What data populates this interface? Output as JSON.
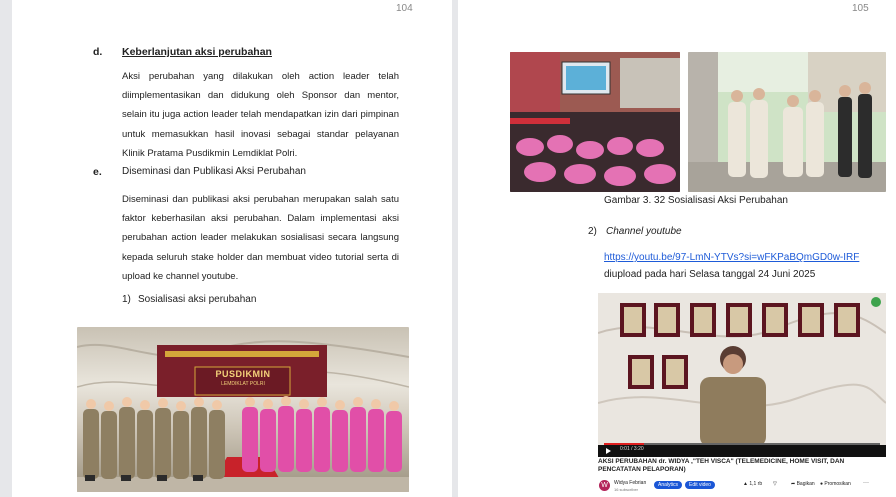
{
  "left_page": {
    "page_number": "104",
    "section_d": {
      "marker": "d.",
      "heading": "Keberlanjutan aksi perubahan",
      "body": "Aksi perubahan yang dilakukan oleh action leader telah diimplementasikan dan didukung oleh Sponsor dan mentor, selain itu juga action leader telah mendapatkan izin dari pimpinan untuk memasukkan hasil inovasi sebagai standar pelayanan Klinik Pratama Pusdikmin Lemdiklat Polri."
    },
    "section_e": {
      "marker": "e.",
      "heading": "Diseminasi dan Publikasi Aksi Perubahan",
      "body": "Diseminasi dan publikasi aksi perubahan merupakan salah satu faktor keberhasilan aksi perubahan. Dalam implementasi aksi perubahan action leader melakukan sosialisasi secara langsung kepada seluruh stake holder dan membuat video tutorial serta di upload ke channel youtube."
    },
    "subitem_1": {
      "marker": "1)",
      "label": "Sosialisasi aksi perubahan"
    },
    "photo_banner_line1": "PUSDIKMIN",
    "photo_banner_line2": "LEMDIKLAT POLRI"
  },
  "right_page": {
    "page_number": "105",
    "figure_caption": "Gambar 3. 32 Sosialisasi Aksi Perubahan",
    "subitem_2": {
      "marker": "2)",
      "label": "Channel youtube"
    },
    "link": "https://youtu.be/97-LmN-YTVs?si=wFKPaBQmGD0w-IRF",
    "upload_note": "diupload pada hari Selasa tanggal 24 Juni 2025",
    "video": {
      "title": "AKSI PERUBAHAN dr. WIDYA ,\"TEH VISCA\" (TELEMEDICINE, HOME VISIT, DAN PENCATATAN PELAPORAN)",
      "channel_name": "Widya Febrian",
      "subscribers": "16 subscriber",
      "btn_analytics": "Analytics",
      "btn_edit": "Edit video",
      "likes": "1,1 rb",
      "share": "Bagikan",
      "promote": "Promosikan",
      "avatar_letter": "W",
      "time": "0:01 / 3:20"
    }
  },
  "colors": {
    "accent_blue": "#1a56d6",
    "link_blue": "#1e5bd8",
    "squiggle_red": "#c33333"
  }
}
